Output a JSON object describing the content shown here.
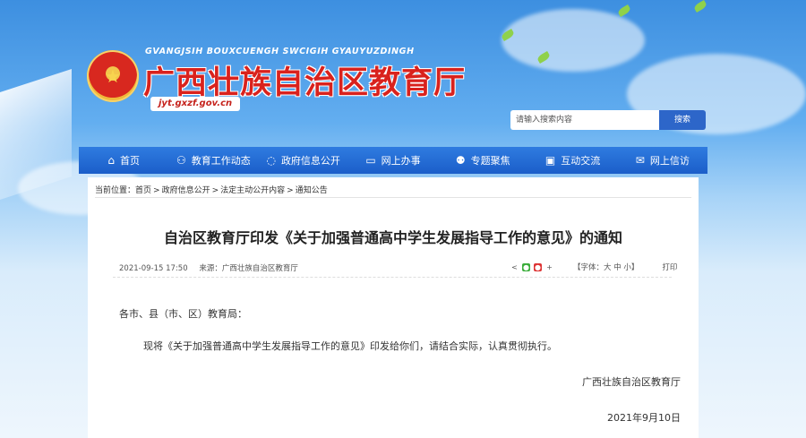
{
  "header": {
    "pinyin": "GVANGJSIH BOUXCUENGH SWCIGIH GYAUYUZDINGH",
    "title": "广西壮族自治区教育厅",
    "domain": "jyt.gxzf.gov.cn",
    "emblem_icon": "national-emblem"
  },
  "search": {
    "placeholder": "请输入搜索内容",
    "button_label": "搜索"
  },
  "nav": {
    "items": [
      {
        "label": "首页",
        "icon": "home-icon"
      },
      {
        "label": "教育工作动态",
        "icon": "sitemap-icon"
      },
      {
        "label": "政府信息公开",
        "icon": "chat-icon"
      },
      {
        "label": "网上办事",
        "icon": "monitor-icon"
      },
      {
        "label": "专题聚焦",
        "icon": "people-icon"
      },
      {
        "label": "互动交流",
        "icon": "projector-icon"
      },
      {
        "label": "网上信访",
        "icon": "envelope-icon"
      }
    ]
  },
  "breadcrumb": {
    "prefix": "当前位置：",
    "items": [
      "首页",
      "政府信息公开",
      "法定主动公开内容",
      "通知公告"
    ],
    "separator": ">"
  },
  "article": {
    "title": "自治区教育厅印发《关于加强普通高中学生发展指导工作的意见》的通知",
    "datetime": "2021-09-15 17:50",
    "source": "来源：广西壮族自治区教育厅",
    "font_size_label": "【字体：大 中 小】",
    "print_label": "打印",
    "greeting": "各市、县（市、区）教育局：",
    "body": "现将《关于加强普通高中学生发展指导工作的意见》印发给你们，请结合实际，认真贯彻执行。",
    "signer": "广西壮族自治区教育厅",
    "sign_date": "2021年9月10日"
  },
  "colors": {
    "brand_red": "#d9221d",
    "nav_blue": "#1b5ec9",
    "search_button": "#2d66c9"
  }
}
